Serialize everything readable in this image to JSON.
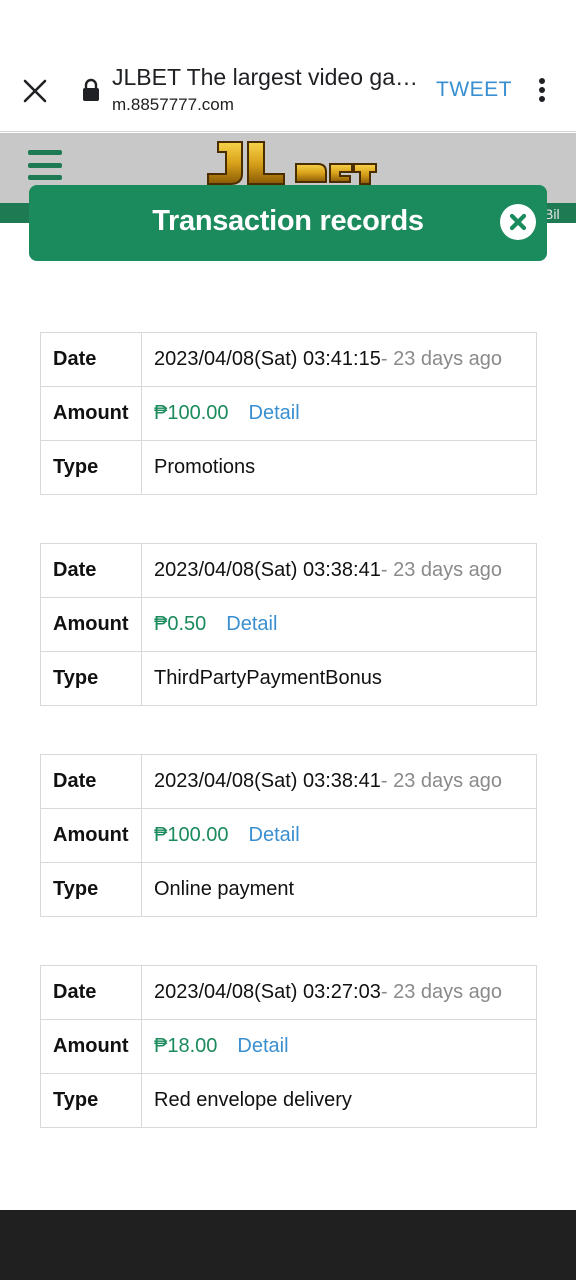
{
  "browser": {
    "page_title": "JLBET The largest video ga…",
    "url": "m.8857777.com",
    "tweet_label": "TWEET"
  },
  "site": {
    "logo_text": "JLBET",
    "ticker_text": "Bil"
  },
  "modal": {
    "title": "Transaction records"
  },
  "labels": {
    "date": "Date",
    "amount": "Amount",
    "type": "Type",
    "detail": "Detail"
  },
  "records": [
    {
      "date": "2023/04/08(Sat) 03:41:15",
      "ago": "- 23 days ago",
      "amount": "₱100.00",
      "type": "Promotions"
    },
    {
      "date": "2023/04/08(Sat) 03:38:41",
      "ago": "- 23 days ago",
      "amount": "₱0.50",
      "type": "ThirdPartyPaymentBonus"
    },
    {
      "date": "2023/04/08(Sat) 03:38:41",
      "ago": "- 23 days ago",
      "amount": "₱100.00",
      "type": "Online payment"
    },
    {
      "date": "2023/04/08(Sat) 03:27:03",
      "ago": "- 23 days ago",
      "amount": "₱18.00",
      "type": "Red envelope delivery"
    }
  ]
}
